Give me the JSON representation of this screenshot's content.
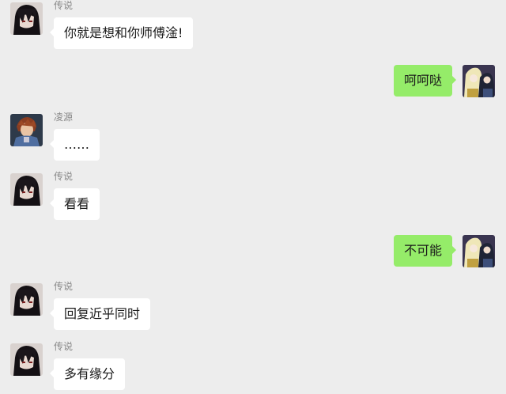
{
  "colors": {
    "background": "#ededed",
    "bubble_incoming": "#ffffff",
    "bubble_outgoing": "#95ec69",
    "sender_name": "#888888"
  },
  "messages": [
    {
      "direction": "incoming",
      "sender": "传说",
      "text": "你就是想和你师傅淦!",
      "avatar": "avatar-dark-hair-icon"
    },
    {
      "direction": "outgoing",
      "text": "呵呵哒",
      "avatar": "avatar-anime-duo-icon"
    },
    {
      "direction": "incoming",
      "sender": "凌源",
      "text": "……",
      "avatar": "avatar-armored-boy-icon"
    },
    {
      "direction": "incoming",
      "sender": "传说",
      "text": "看看",
      "avatar": "avatar-dark-hair-icon"
    },
    {
      "direction": "outgoing",
      "text": "不可能",
      "avatar": "avatar-anime-duo-icon"
    },
    {
      "direction": "incoming",
      "sender": "传说",
      "text": "回复近乎同时",
      "avatar": "avatar-dark-hair-icon"
    },
    {
      "direction": "incoming",
      "sender": "传说",
      "text": "多有缘分",
      "avatar": "avatar-dark-hair-icon"
    }
  ]
}
